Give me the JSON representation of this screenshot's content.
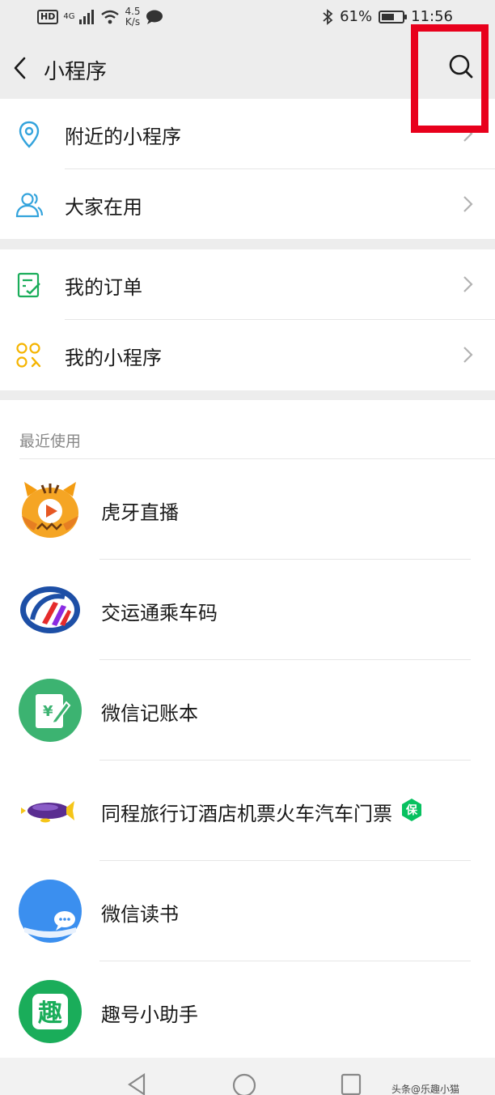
{
  "status_bar": {
    "hd": "HD",
    "network": "4G",
    "speed_value": "4.5",
    "speed_unit": "K/s",
    "battery_percent": "61%",
    "battery_level": 0.61,
    "time": "11:56"
  },
  "nav": {
    "title": "小程序"
  },
  "menu_group_1": [
    {
      "label": "附近的小程序",
      "icon": "location-pin-icon"
    },
    {
      "label": "大家在用",
      "icon": "users-icon"
    }
  ],
  "menu_group_2": [
    {
      "label": "我的订单",
      "icon": "order-list-icon"
    },
    {
      "label": "我的小程序",
      "icon": "mini-program-grid-icon"
    }
  ],
  "recent": {
    "header": "最近使用",
    "apps": [
      {
        "label": "虎牙直播",
        "icon": "huya-tiger-icon"
      },
      {
        "label": "交运通乘车码",
        "icon": "jiaoyuntong-icon"
      },
      {
        "label": "微信记账本",
        "icon": "wechat-ledger-icon"
      },
      {
        "label": "同程旅行订酒店机票火车汽车门票",
        "icon": "tongcheng-blimp-icon",
        "badge": "保"
      },
      {
        "label": "微信读书",
        "icon": "wechat-reading-icon"
      },
      {
        "label": "趣号小助手",
        "icon": "quhao-icon",
        "glyph": "趣"
      }
    ]
  },
  "colors": {
    "accent_green": "#07c160",
    "highlight_red": "#e8001c",
    "location_blue": "#33a3dc",
    "order_green": "#1aad5a",
    "grid_yellow": "#f5b400"
  },
  "watermark": "头条@乐趣小猫"
}
